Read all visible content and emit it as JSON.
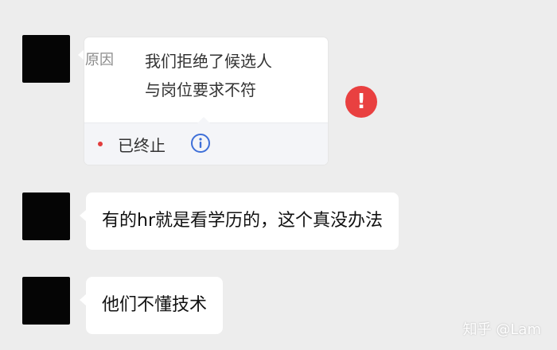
{
  "messages": [
    {
      "type": "card",
      "tag": "原因",
      "lines": [
        "我们拒绝了候选人",
        "与岗位要求不符"
      ],
      "status": "已终止",
      "status_dot_color": "#e23d3d",
      "info_icon": "info-circle-icon",
      "failed": true,
      "failed_icon": "exclamation-circle-icon"
    },
    {
      "type": "text",
      "text": "有的hr就是看学历的，这个真没办法"
    },
    {
      "type": "text",
      "text": "他们不懂技术"
    }
  ],
  "watermark": "知乎 @Lam",
  "colors": {
    "background": "#ededed",
    "bubble": "#ffffff",
    "error": "#e94040",
    "info": "#3e6fd8"
  }
}
